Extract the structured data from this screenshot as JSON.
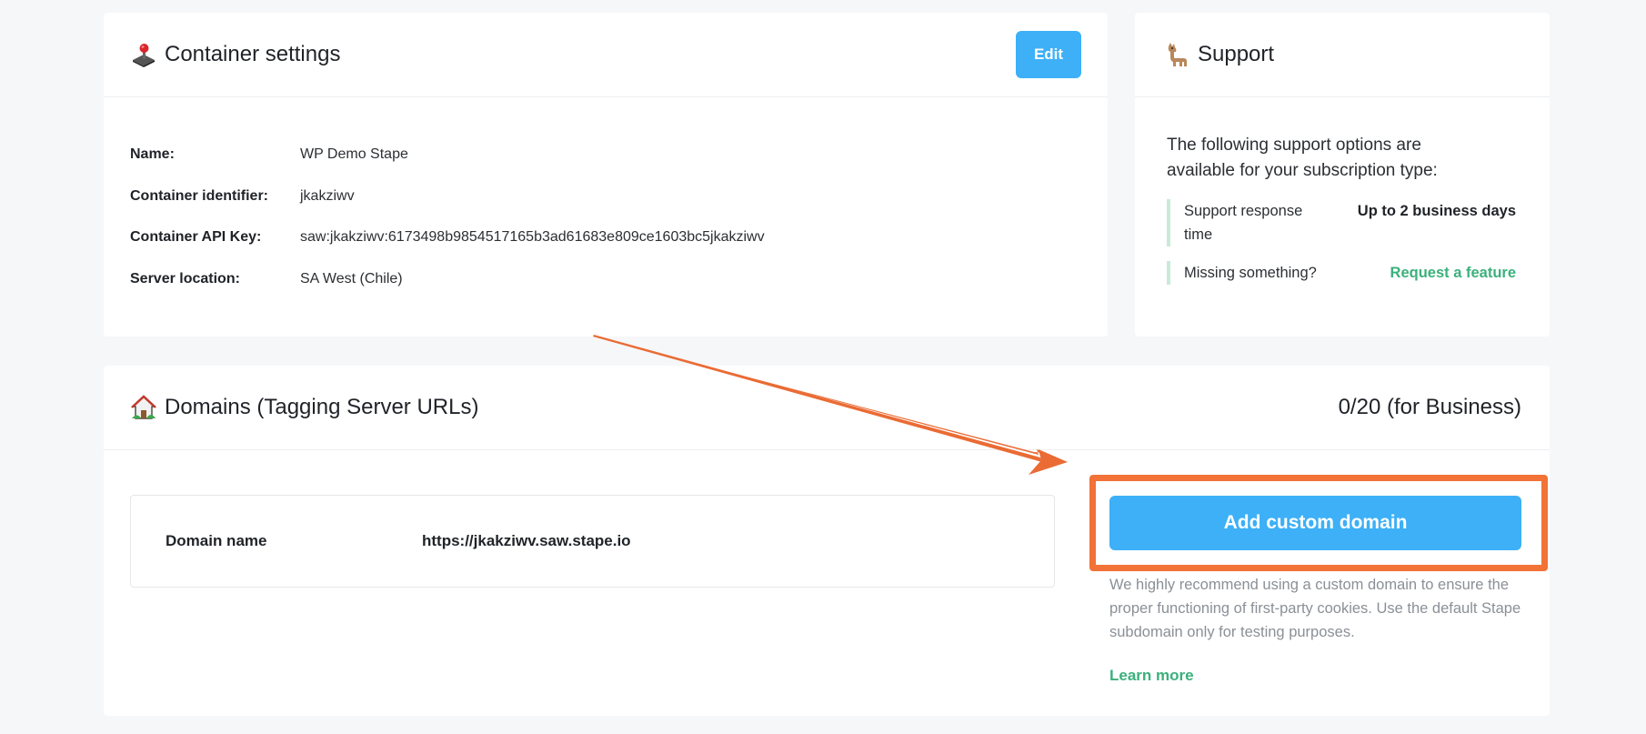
{
  "settings": {
    "title": "Container settings",
    "edit_label": "Edit",
    "fields": [
      {
        "label": "Name:",
        "value": "WP Demo Stape"
      },
      {
        "label": "Container identifier:",
        "value": "jkakziwv"
      },
      {
        "label": "Container API Key:",
        "value": "saw:jkakziwv:6173498b9854517165b3ad61683e809ce1603bc5jkakziwv"
      },
      {
        "label": "Server location:",
        "value": "SA West (Chile)"
      }
    ],
    "icon": "joystick-icon"
  },
  "support": {
    "title": "Support",
    "icon": "llama-icon",
    "intro": "The following support options are available for your subscription type:",
    "rows": [
      {
        "label": "Support response time",
        "value": "Up to 2 business days"
      },
      {
        "label": "Missing something?",
        "link": "Request a feature"
      }
    ]
  },
  "domains": {
    "title": "Domains (Tagging Server URLs)",
    "icon": "house-icon",
    "count": "0/20 (for Business)",
    "domain_label": "Domain name",
    "domain_value": "https://jkakziwv.saw.stape.io",
    "add_label": "Add custom domain",
    "recommend": "We highly recommend using a custom domain to ensure the proper functioning of first-party cookies. Use the default Stape subdomain only for testing purposes.",
    "learn_more": "Learn more"
  },
  "colors": {
    "accent_blue": "#3db0f7",
    "link_green": "#3bb07c",
    "annotation_orange": "#f27237"
  }
}
